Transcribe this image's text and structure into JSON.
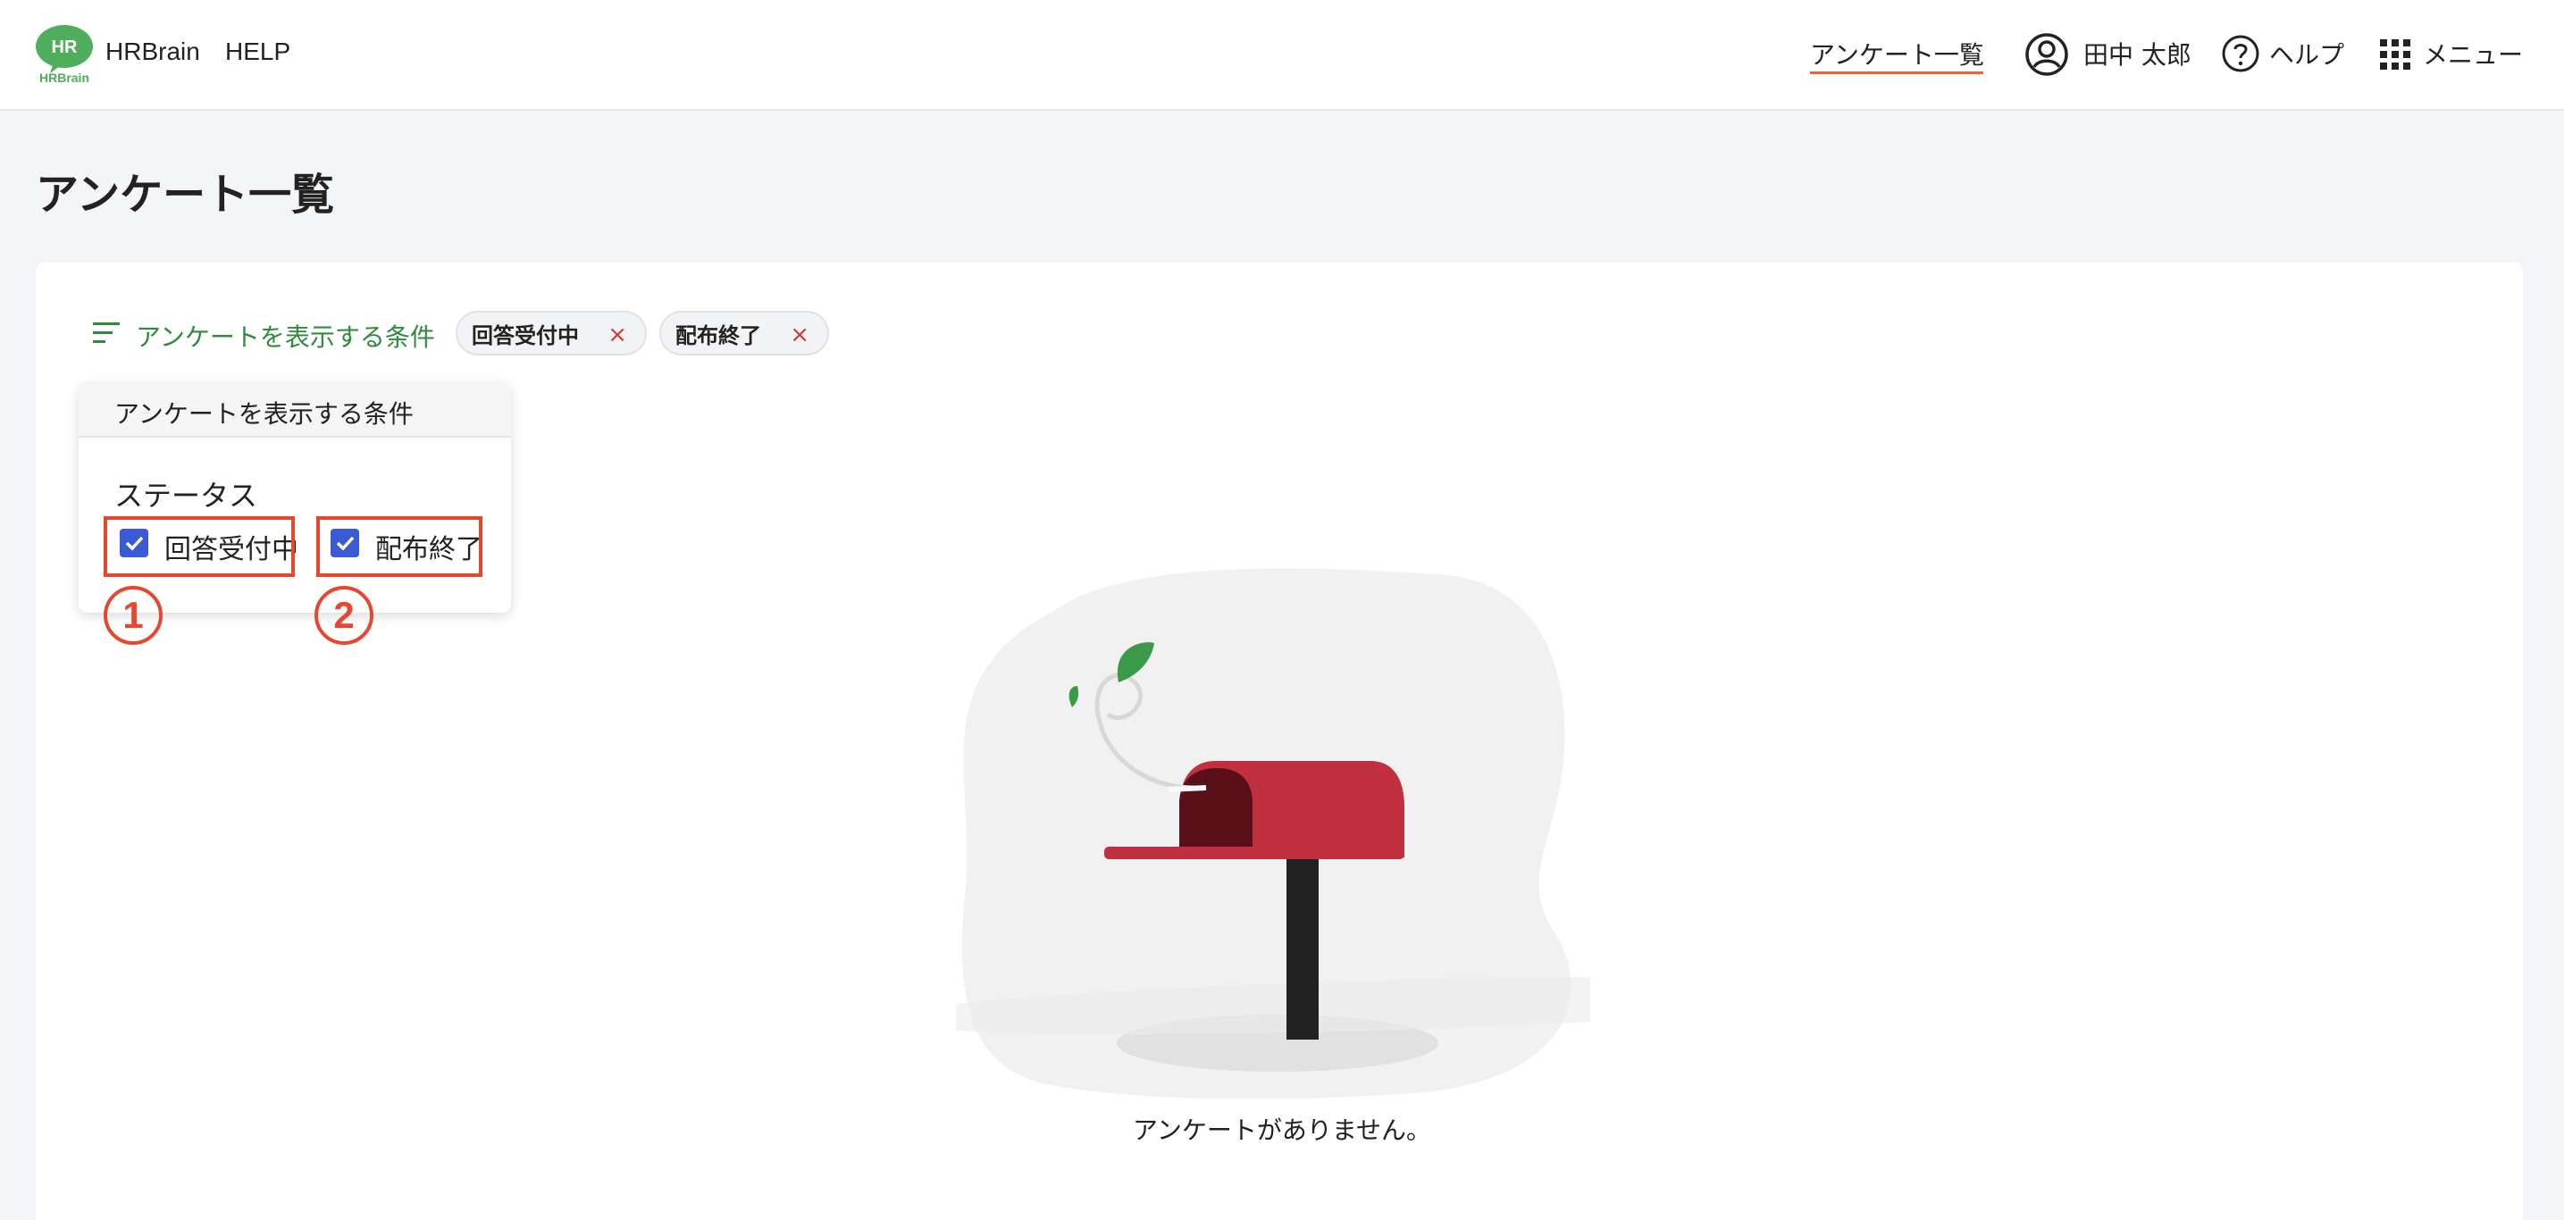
{
  "header": {
    "logo_text": "HR",
    "logo_subtext": "HRBrain",
    "brand_name": "HRBrain",
    "help_link": "HELP",
    "nav_active": "アンケート一覧",
    "user_name": "田中 太郎",
    "help_label": "ヘルプ",
    "menu_label": "メニュー"
  },
  "page": {
    "title": "アンケート一覧"
  },
  "filter": {
    "toggle_label": "アンケートを表示する条件",
    "chips": [
      {
        "label": "回答受付中",
        "remove": "×"
      },
      {
        "label": "配布終了",
        "remove": "×"
      }
    ]
  },
  "popover": {
    "title": "アンケートを表示する条件",
    "section_label": "ステータス",
    "options": [
      {
        "label": "回答受付中",
        "checked": true
      },
      {
        "label": "配布終了",
        "checked": true
      }
    ]
  },
  "annotations": {
    "marker_1": "1",
    "marker_2": "2"
  },
  "empty_state": {
    "message": "アンケートがありません。"
  },
  "colors": {
    "accent_green": "#2e8b3c",
    "nav_underline": "#e8643a",
    "checkbox_blue": "#3b5bd6",
    "annotation_red": "#e5482f",
    "mailbox_red": "#c0303e"
  }
}
